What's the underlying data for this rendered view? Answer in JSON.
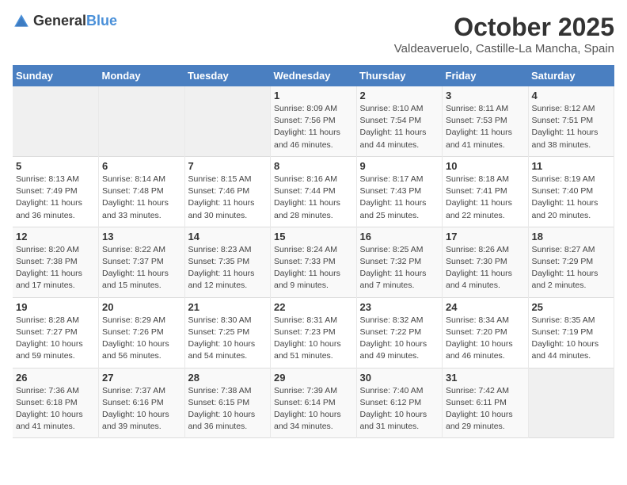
{
  "header": {
    "logo_general": "General",
    "logo_blue": "Blue",
    "month": "October 2025",
    "location": "Valdeaveruelo, Castille-La Mancha, Spain"
  },
  "weekdays": [
    "Sunday",
    "Monday",
    "Tuesday",
    "Wednesday",
    "Thursday",
    "Friday",
    "Saturday"
  ],
  "weeks": [
    [
      {
        "day": "",
        "info": ""
      },
      {
        "day": "",
        "info": ""
      },
      {
        "day": "",
        "info": ""
      },
      {
        "day": "1",
        "info": "Sunrise: 8:09 AM\nSunset: 7:56 PM\nDaylight: 11 hours\nand 46 minutes."
      },
      {
        "day": "2",
        "info": "Sunrise: 8:10 AM\nSunset: 7:54 PM\nDaylight: 11 hours\nand 44 minutes."
      },
      {
        "day": "3",
        "info": "Sunrise: 8:11 AM\nSunset: 7:53 PM\nDaylight: 11 hours\nand 41 minutes."
      },
      {
        "day": "4",
        "info": "Sunrise: 8:12 AM\nSunset: 7:51 PM\nDaylight: 11 hours\nand 38 minutes."
      }
    ],
    [
      {
        "day": "5",
        "info": "Sunrise: 8:13 AM\nSunset: 7:49 PM\nDaylight: 11 hours\nand 36 minutes."
      },
      {
        "day": "6",
        "info": "Sunrise: 8:14 AM\nSunset: 7:48 PM\nDaylight: 11 hours\nand 33 minutes."
      },
      {
        "day": "7",
        "info": "Sunrise: 8:15 AM\nSunset: 7:46 PM\nDaylight: 11 hours\nand 30 minutes."
      },
      {
        "day": "8",
        "info": "Sunrise: 8:16 AM\nSunset: 7:44 PM\nDaylight: 11 hours\nand 28 minutes."
      },
      {
        "day": "9",
        "info": "Sunrise: 8:17 AM\nSunset: 7:43 PM\nDaylight: 11 hours\nand 25 minutes."
      },
      {
        "day": "10",
        "info": "Sunrise: 8:18 AM\nSunset: 7:41 PM\nDaylight: 11 hours\nand 22 minutes."
      },
      {
        "day": "11",
        "info": "Sunrise: 8:19 AM\nSunset: 7:40 PM\nDaylight: 11 hours\nand 20 minutes."
      }
    ],
    [
      {
        "day": "12",
        "info": "Sunrise: 8:20 AM\nSunset: 7:38 PM\nDaylight: 11 hours\nand 17 minutes."
      },
      {
        "day": "13",
        "info": "Sunrise: 8:22 AM\nSunset: 7:37 PM\nDaylight: 11 hours\nand 15 minutes."
      },
      {
        "day": "14",
        "info": "Sunrise: 8:23 AM\nSunset: 7:35 PM\nDaylight: 11 hours\nand 12 minutes."
      },
      {
        "day": "15",
        "info": "Sunrise: 8:24 AM\nSunset: 7:33 PM\nDaylight: 11 hours\nand 9 minutes."
      },
      {
        "day": "16",
        "info": "Sunrise: 8:25 AM\nSunset: 7:32 PM\nDaylight: 11 hours\nand 7 minutes."
      },
      {
        "day": "17",
        "info": "Sunrise: 8:26 AM\nSunset: 7:30 PM\nDaylight: 11 hours\nand 4 minutes."
      },
      {
        "day": "18",
        "info": "Sunrise: 8:27 AM\nSunset: 7:29 PM\nDaylight: 11 hours\nand 2 minutes."
      }
    ],
    [
      {
        "day": "19",
        "info": "Sunrise: 8:28 AM\nSunset: 7:27 PM\nDaylight: 10 hours\nand 59 minutes."
      },
      {
        "day": "20",
        "info": "Sunrise: 8:29 AM\nSunset: 7:26 PM\nDaylight: 10 hours\nand 56 minutes."
      },
      {
        "day": "21",
        "info": "Sunrise: 8:30 AM\nSunset: 7:25 PM\nDaylight: 10 hours\nand 54 minutes."
      },
      {
        "day": "22",
        "info": "Sunrise: 8:31 AM\nSunset: 7:23 PM\nDaylight: 10 hours\nand 51 minutes."
      },
      {
        "day": "23",
        "info": "Sunrise: 8:32 AM\nSunset: 7:22 PM\nDaylight: 10 hours\nand 49 minutes."
      },
      {
        "day": "24",
        "info": "Sunrise: 8:34 AM\nSunset: 7:20 PM\nDaylight: 10 hours\nand 46 minutes."
      },
      {
        "day": "25",
        "info": "Sunrise: 8:35 AM\nSunset: 7:19 PM\nDaylight: 10 hours\nand 44 minutes."
      }
    ],
    [
      {
        "day": "26",
        "info": "Sunrise: 7:36 AM\nSunset: 6:18 PM\nDaylight: 10 hours\nand 41 minutes."
      },
      {
        "day": "27",
        "info": "Sunrise: 7:37 AM\nSunset: 6:16 PM\nDaylight: 10 hours\nand 39 minutes."
      },
      {
        "day": "28",
        "info": "Sunrise: 7:38 AM\nSunset: 6:15 PM\nDaylight: 10 hours\nand 36 minutes."
      },
      {
        "day": "29",
        "info": "Sunrise: 7:39 AM\nSunset: 6:14 PM\nDaylight: 10 hours\nand 34 minutes."
      },
      {
        "day": "30",
        "info": "Sunrise: 7:40 AM\nSunset: 6:12 PM\nDaylight: 10 hours\nand 31 minutes."
      },
      {
        "day": "31",
        "info": "Sunrise: 7:42 AM\nSunset: 6:11 PM\nDaylight: 10 hours\nand 29 minutes."
      },
      {
        "day": "",
        "info": ""
      }
    ]
  ]
}
